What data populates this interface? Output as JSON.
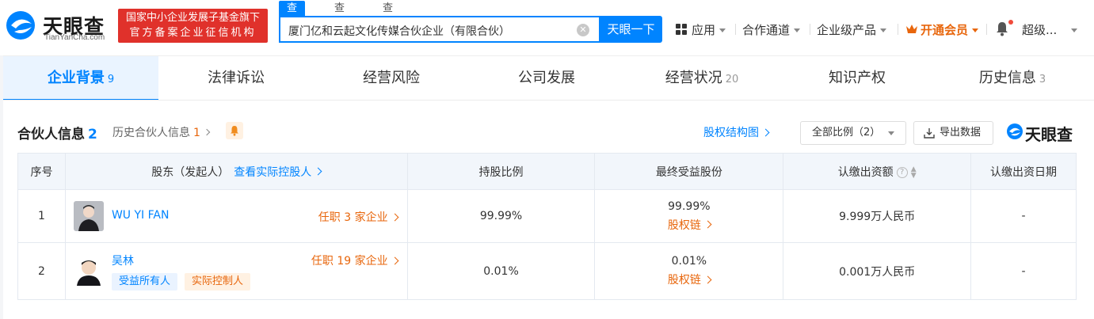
{
  "header": {
    "logo_text": "天眼查",
    "logo_sub": "TianYanCha.com",
    "gov_badge_line1": "国家中小企业发展子基金旗下",
    "gov_badge_line2": "官方备案企业征信机构",
    "search_tabs": [
      "查公司",
      "查老板",
      "查关系"
    ],
    "search_value": "厦门亿和云起文化传媒合伙企业（有限合伙）",
    "search_button": "天眼一下",
    "nav": {
      "apps": "应用",
      "channel": "合作通道",
      "enterprise": "企业级产品",
      "vip": "开通会员",
      "user": "超级..."
    }
  },
  "tabs": [
    {
      "label": "企业背景",
      "count": "9"
    },
    {
      "label": "法律诉讼",
      "count": ""
    },
    {
      "label": "经营风险",
      "count": ""
    },
    {
      "label": "公司发展",
      "count": ""
    },
    {
      "label": "经营状况",
      "count": "20"
    },
    {
      "label": "知识产权",
      "count": ""
    },
    {
      "label": "历史信息",
      "count": "3"
    }
  ],
  "section": {
    "title": "合伙人信息",
    "count": "2",
    "history_label": "历史合伙人信息",
    "history_count": "1",
    "equity_link": "股权结构图",
    "ratio_select": "全部比例（2）",
    "export_button": "导出数据",
    "brand": "天眼查"
  },
  "table": {
    "headers": {
      "index": "序号",
      "shareholder": "股东（发起人）",
      "controller_link": "查看实际控股人",
      "ratio": "持股比例",
      "beneficial": "最终受益股份",
      "subscribed": "认缴出资额",
      "date": "认缴出资日期"
    },
    "rows": [
      {
        "index": "1",
        "name": "WU YI FAN",
        "jobs": "任职 3 家企业",
        "ratio": "99.99%",
        "beneficial": "99.99%",
        "chain": "股权链",
        "subscribed": "9.999万人民币",
        "date": "-",
        "tags": []
      },
      {
        "index": "2",
        "name": "吴林",
        "jobs": "任职 19 家企业",
        "ratio": "0.01%",
        "beneficial": "0.01%",
        "chain": "股权链",
        "subscribed": "0.001万人民币",
        "date": "-",
        "tags": [
          "受益所有人",
          "实际控制人"
        ]
      }
    ]
  },
  "colors": {
    "accent": "#0084ff",
    "orange": "#e8660c",
    "gov_red": "#e0312b"
  }
}
